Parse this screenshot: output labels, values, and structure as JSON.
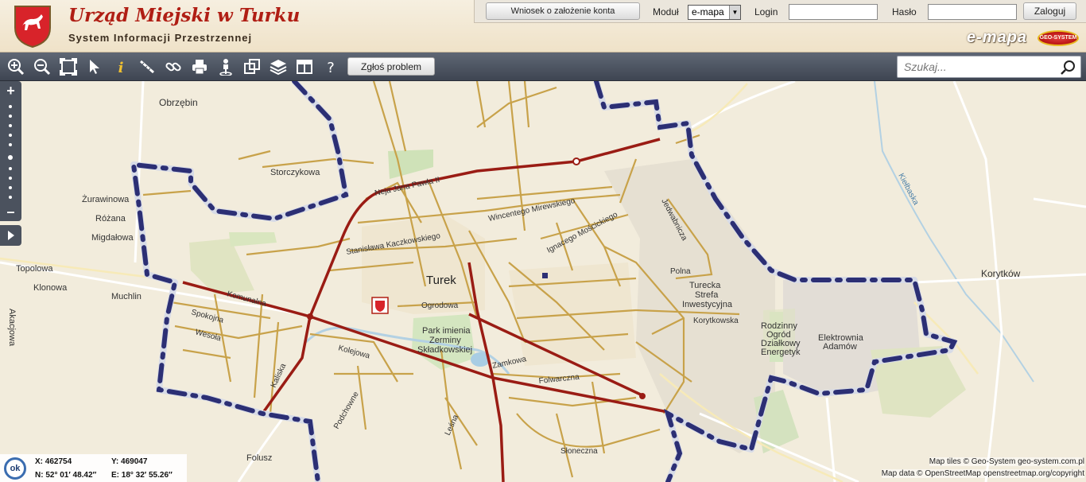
{
  "header": {
    "title": "Urząd Miejski w Turku",
    "subtitle": "System Informacji Przestrzennej",
    "brand": "e-mapa",
    "brand_logo_text": "GEO-SYSTEM",
    "account_request": "Wniosek o założenie konta",
    "module_label": "Moduł",
    "module_value": "e-mapa",
    "login_label": "Login",
    "password_label": "Hasło",
    "login_button": "Zaloguj"
  },
  "toolbar": {
    "tools": [
      "zoom-in-icon",
      "zoom-out-icon",
      "zoom-extent-icon",
      "select-pointer-icon",
      "info-icon",
      "measure-icon",
      "link-icon",
      "print-icon",
      "locate-person-icon",
      "layers-compare-icon",
      "layers-icon",
      "layout-icon",
      "help-icon"
    ],
    "report_button": "Zgłoś problem",
    "search_placeholder": "Szukaj..."
  },
  "map": {
    "labels": {
      "obrzebin": "Obrzębin",
      "storczykowa": "Storczykowa",
      "zurawinowa": "Żurawinowa",
      "rozana": "Różana",
      "migdalowa": "Migdałowa",
      "topolowa": "Topolowa",
      "klonowa": "Klonowa",
      "muchlin": "Muchlin",
      "akacjowa": "Akacjowa",
      "turek": "Turek",
      "park_l1": "Park imienia",
      "park_l2": "Zerminy",
      "park_l3": "Składkowskiej",
      "ogrodowa": "Ogrodowa",
      "strefa_l1": "Turecka",
      "strefa_l2": "Strefa",
      "strefa_l3": "Inwestycyjna",
      "korytkowska": "Korytkowska",
      "ogrod_l1": "Rodzinny",
      "ogrod_l2": "Ogród",
      "ogrod_l3": "Działkowy",
      "ogrod_l4": "Energetyk",
      "elektr_l1": "Elektrownia",
      "elektr_l2": "Adamów",
      "korytkow": "Korytków",
      "kielbaska": "Kiełbaska",
      "folusz": "Folusz",
      "polna": "Polna",
      "ignacego": "Ignacego Mościckiego",
      "wincentego": "Wincentego Mirewskiego",
      "stanislawa": "Stanisława Kaczkowskiego",
      "jana_pawla": "Neja Jana Pawła II",
      "kaliska": "Kaliska",
      "spokojna": "Spokojna",
      "wesola": "Wesoła",
      "polna2": "Komunalna",
      "jadwabna": "Jedwabnicza",
      "slonecza": "Słoneczna",
      "folwarczna": "Folwarczna",
      "lesna": "Leśna",
      "zamkowa": "Zamkowa",
      "kolejowa": "Kolejowa",
      "podlesna": "Podchowne"
    }
  },
  "coords": {
    "ok": "ok",
    "x": "X: 462754",
    "y": "Y: 469047",
    "n": "N: 52° 01′ 48.42″",
    "e": "E: 18° 32′ 55.26″"
  },
  "attribution": {
    "tiles": "Map tiles © Geo-System geo-system.com.pl",
    "data": "Map data © OpenStreetMap openstreetmap.org/copyright"
  }
}
